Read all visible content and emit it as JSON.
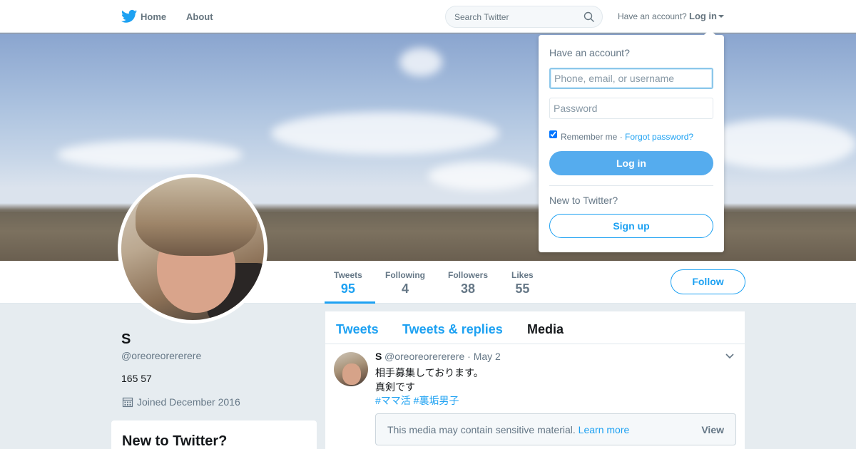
{
  "nav": {
    "home_label": "Home",
    "about_label": "About",
    "search_placeholder": "Search Twitter",
    "have_account_label": "Have an account?",
    "login_label": "Log in"
  },
  "profile": {
    "name": "S",
    "handle": "@oreoreorererere",
    "bio": "165 57",
    "joined": "Joined December 2016",
    "follow_label": "Follow"
  },
  "stats": [
    {
      "label": "Tweets",
      "value": "95",
      "active": true
    },
    {
      "label": "Following",
      "value": "4"
    },
    {
      "label": "Followers",
      "value": "38"
    },
    {
      "label": "Likes",
      "value": "55"
    }
  ],
  "timeline": {
    "tabs": [
      {
        "label": "Tweets"
      },
      {
        "label": "Tweets & replies"
      },
      {
        "label": "Media",
        "current": true
      }
    ],
    "tweet": {
      "name": "S",
      "handle_date": "@oreoreorererere · May 2",
      "lines": [
        "相手募集しております。",
        "真剣です"
      ],
      "hashtags": "#ママ活 #裏垢男子",
      "sensitive_text": "This media may contain sensitive material.",
      "learn_more": "Learn more",
      "view_label": "View"
    }
  },
  "sidebar_box": {
    "title": "New to Twitter?"
  },
  "login_dropdown": {
    "title": "Have an account?",
    "username_placeholder": "Phone, email, or username",
    "password_placeholder": "Password",
    "remember_label": "Remember me ·",
    "forgot_label": "Forgot password?",
    "login_button": "Log in",
    "new_label": "New to Twitter?",
    "signup_button": "Sign up"
  },
  "colors": {
    "accent": "#1da1f2",
    "login_button": "#55acee",
    "background": "#e6ecf0"
  }
}
